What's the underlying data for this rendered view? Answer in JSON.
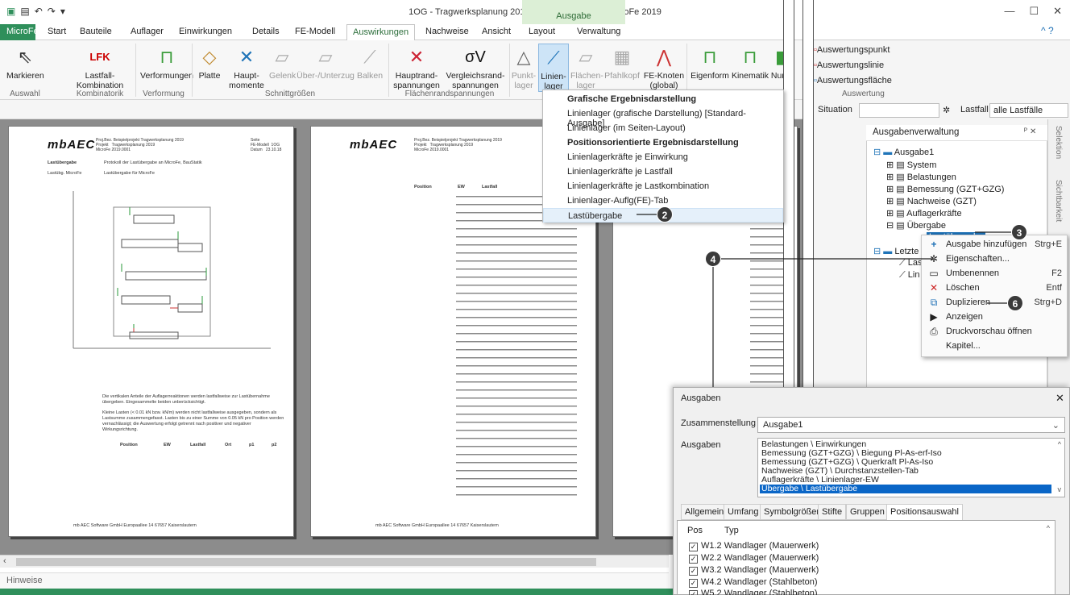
{
  "window": {
    "title": "1OG - Tragwerksplanung 2019 - Plattentragwerk - MicroFe 2019",
    "context_tab_header": "Ausgabe"
  },
  "tabs": [
    "MicroFe",
    "Start",
    "Bauteile",
    "Auflager",
    "Einwirkungen",
    "Details",
    "FE-Modell",
    "Auswirkungen",
    "Nachweise",
    "Ansicht",
    "Layout",
    "Verwaltung"
  ],
  "ribbon": {
    "buttons": [
      {
        "label": "Markieren"
      },
      {
        "label": "Lastfall-\nKombination"
      },
      {
        "label": "Verformungen"
      },
      {
        "label": "Platte"
      },
      {
        "label": "Haupt-\nmomente"
      },
      {
        "label": "Gelenk"
      },
      {
        "label": "Über-/Unterzug"
      },
      {
        "label": "Balken"
      },
      {
        "label": "Hauptrand-\nspannungen"
      },
      {
        "label": "Vergleichsrand-\nspannungen"
      },
      {
        "label": "Punkt-\nlager"
      },
      {
        "label": "Linien-\nlager"
      },
      {
        "label": "Flächen-\nlager"
      },
      {
        "label": "Pfahlkopf"
      },
      {
        "label": "FE-Knoten\n(global)"
      },
      {
        "label": "Eigenform"
      },
      {
        "label": "Kinematik"
      },
      {
        "label": "Num"
      }
    ],
    "lfk_text": "LFK",
    "sigma_text": "σV",
    "groups": [
      "Auswahl",
      "Kombinatorik",
      "Verformung",
      "Schnittgrößen",
      "Flächenrandspannungen"
    ],
    "right_links": [
      "Auswertungspunkt",
      "Auswertungslinie",
      "Auswertungsfläche"
    ],
    "right_group": "Auswertung"
  },
  "qbar": {
    "situation_label": "Situation",
    "lastfall_label": "Lastfall",
    "lastfall_value": "alle Lastfälle"
  },
  "dropdown": {
    "items": [
      {
        "label": "Grafische Ergebnisdarstellung",
        "bold": true
      },
      {
        "label": "Linienlager (grafische Darstellung) [Standard-Ausgabe]",
        "bold": false
      },
      {
        "label": "Linienlager (im Seiten-Layout)",
        "bold": false
      },
      {
        "label": "Positionsorientierte Ergebnisdarstellung",
        "bold": true
      },
      {
        "label": "Linienlagerkräfte je Einwirkung",
        "bold": false
      },
      {
        "label": "Linienlagerkräfte je Lastfall",
        "bold": false
      },
      {
        "label": "Linienlagerkräfte je Lastkombination",
        "bold": false
      },
      {
        "label": "Linienlager-Auflg(FE)-Tab",
        "bold": false
      },
      {
        "label": "Lastübergabe",
        "bold": false,
        "selected": true
      }
    ]
  },
  "panel": {
    "title": "Ausgabenverwaltung",
    "pin": "ᴾ ✕",
    "tree": [
      {
        "label": "Ausgabe1",
        "level": 0
      },
      {
        "label": "System",
        "level": 1
      },
      {
        "label": "Belastungen",
        "level": 1
      },
      {
        "label": "Bemessung (GZT+GZG)",
        "level": 1
      },
      {
        "label": "Nachweise (GZT)",
        "level": 1
      },
      {
        "label": "Auflagerkräfte",
        "level": 1
      },
      {
        "label": "Übergabe",
        "level": 1
      },
      {
        "label": "Lastübergabe",
        "level": 2,
        "selected": true
      },
      {
        "label": "Letzte",
        "level": 0
      },
      {
        "label": "Las",
        "level": 1
      },
      {
        "label": "Lin",
        "level": 1
      }
    ],
    "side_tabs": [
      "Selektion",
      "Sichtbarkeit"
    ]
  },
  "context_menu": {
    "items": [
      {
        "icon": "plus-icon",
        "label": "Ausgabe hinzufügen",
        "key": "Strg+E"
      },
      {
        "icon": "settings-icon",
        "label": "Eigenschaften...",
        "key": ""
      },
      {
        "icon": "rename-icon",
        "label": "Umbenennen",
        "key": "F2"
      },
      {
        "icon": "delete-icon",
        "label": "Löschen",
        "key": "Entf"
      },
      {
        "icon": "duplicate-icon",
        "label": "Duplizieren",
        "key": "Strg+D"
      },
      {
        "icon": "play-icon",
        "label": "Anzeigen",
        "key": ""
      },
      {
        "icon": "print-preview-icon",
        "label": "Druckvorschau öffnen",
        "key": ""
      },
      {
        "icon": "",
        "label": "Kapitel...",
        "key": ""
      }
    ]
  },
  "badges": [
    "2",
    "3",
    "4",
    "6"
  ],
  "dialog": {
    "title": "Ausgaben",
    "close": "✕",
    "zusammenstellung_label": "Zusammenstellung",
    "zusammenstellung_value": "Ausgabe1",
    "ausgaben_label": "Ausgaben",
    "ausgaben_items": [
      {
        "label": "Belastungen \\ Einwirkungen"
      },
      {
        "label": "Bemessung (GZT+GZG) \\ Biegung Pl-As-erf-Iso"
      },
      {
        "label": "Bemessung (GZT+GZG) \\ Querkraft Pl-As-Iso"
      },
      {
        "label": "Nachweise (GZT) \\ Durchstanzstellen-Tab"
      },
      {
        "label": "Auflagerkräfte \\ Linienlager-EW"
      },
      {
        "label": "Übergabe \\ Lastübergabe",
        "selected": true
      }
    ],
    "tabs": [
      "Allgemein",
      "Umfang",
      "Symbolgrößen",
      "Stifte",
      "Gruppen",
      "Positionsauswahl"
    ],
    "pos_header": "Pos",
    "typ_header": "Typ",
    "positions": [
      {
        "pos": "W1.2",
        "typ": "Wandlager (Mauerwerk)"
      },
      {
        "pos": "W2.2",
        "typ": "Wandlager (Mauerwerk)"
      },
      {
        "pos": "W3.2",
        "typ": "Wandlager (Mauerwerk)"
      },
      {
        "pos": "W4.2",
        "typ": "Wandlager (Stahlbeton)"
      },
      {
        "pos": "W5.2",
        "typ": "Wandlager (Stahlbeton)"
      }
    ]
  },
  "doc": {
    "logo": "mbAEC",
    "hdr_left": "Proj.Bez. Beispielprojekt Tragwerksplanung 2019\nProjekt   Tragwerksplanung 2019\nMicroFe 2019.0001",
    "hdr_right": "Seite\nFE-Modell  1OG\nDatum   23.10.18",
    "section": "Lastübergabe",
    "section_desc": "Protokoll der Lastübergabe an MicroFe, BauStatik",
    "sub": "Lastübg. MicroFe",
    "sub_desc": "Lastübergabe für MicroFe",
    "para1": "Die vertikalen Anteile der Auflagerreaktionen werden lastfallweise zur Lastübernahme übergeben. Eingesammelte beiden unberücksichtigt.",
    "para2": "Kleine Lasten (< 0.01 kN bzw. kN/m) werden nicht lastfallweise ausgegeben, sondern als Lastsumme zusammengefasst. Lasten bis zu einer Summe von 0.05 kN pro Position werden vernachlässigt; die Auswertung erfolgt getrennt nach positiver und negativer Wirkungsrichtung.",
    "table_headers": [
      "Position",
      "EW",
      "Lastfall",
      "Ort",
      "p1",
      "p2"
    ],
    "footer": "mb AEC Software GmbH  Europaallee 14  67657 Kaiserslautern"
  },
  "statusbar": {
    "hint": "Hinweise"
  }
}
